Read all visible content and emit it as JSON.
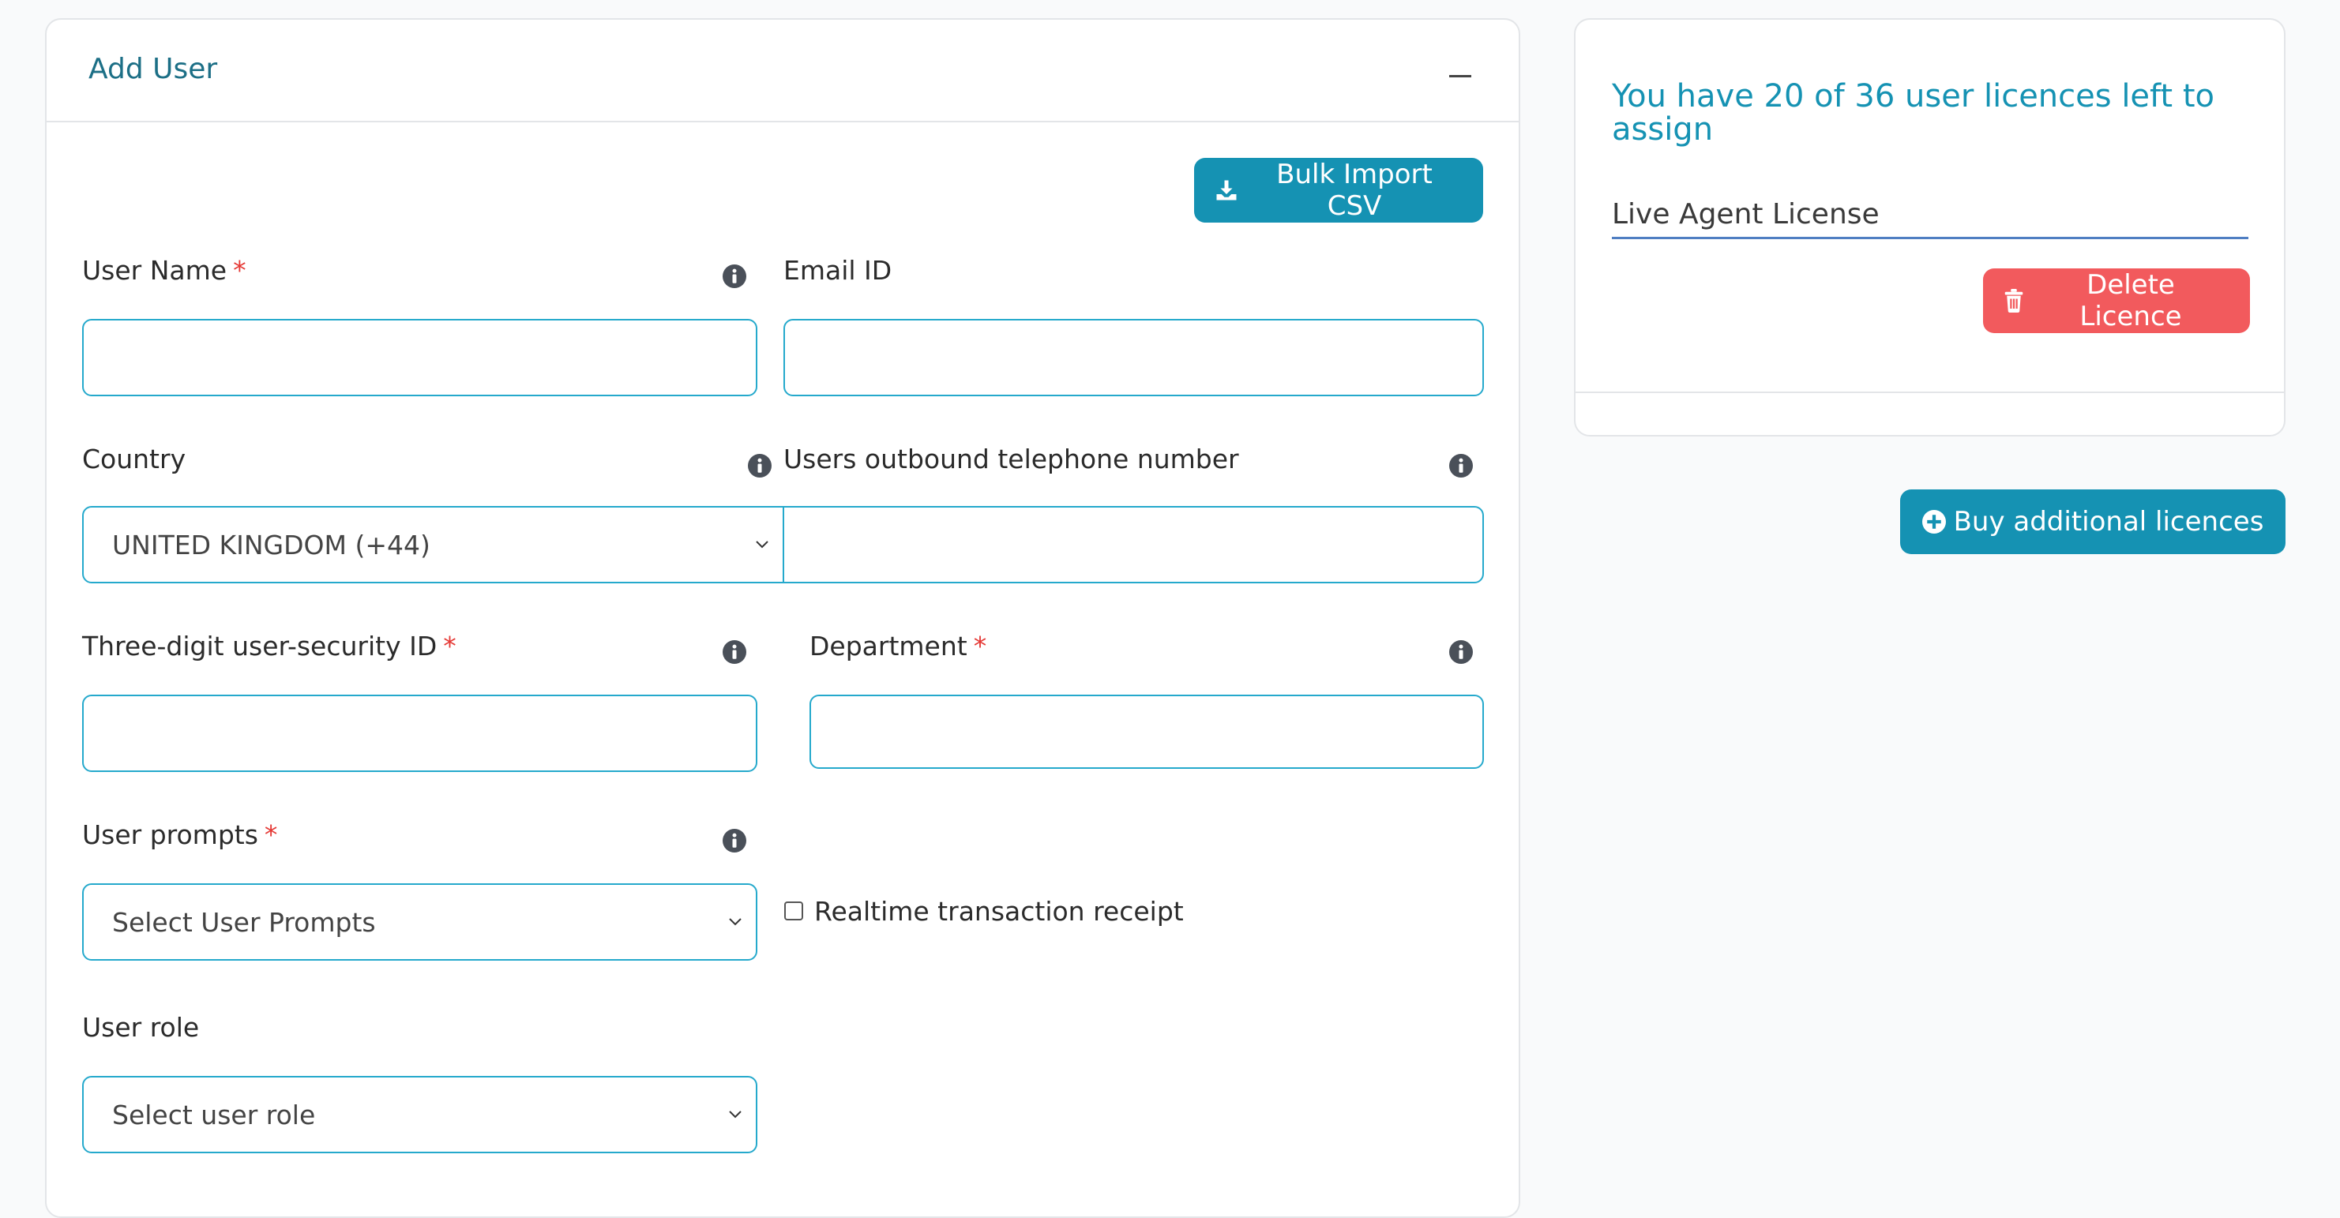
{
  "add_user": {
    "title": "Add User",
    "bulk_import_label": "Bulk Import CSV",
    "fields": {
      "user_name": {
        "label": "User Name",
        "required_mark": "*"
      },
      "email": {
        "label": "Email ID"
      },
      "country": {
        "label": "Country",
        "selected": "UNITED KINGDOM (+44)"
      },
      "outbound_phone": {
        "label": "Users outbound telephone number"
      },
      "security_id": {
        "label": "Three-digit user-security ID",
        "required_mark": "*"
      },
      "department": {
        "label": "Department",
        "required_mark": "*"
      },
      "user_prompts": {
        "label": "User prompts",
        "required_mark": "*",
        "selected": "Select User Prompts"
      },
      "realtime_receipt": {
        "label": "Realtime transaction receipt",
        "checked": false
      },
      "user_role": {
        "label": "User role",
        "selected": "Select user role"
      }
    }
  },
  "licences": {
    "summary": "You have 20 of 36 user licences left to assign",
    "licence_name": "Live Agent License",
    "delete_label": "Delete Licence",
    "buy_label": "Buy additional licences"
  },
  "icons": {
    "collapse": "minus-icon",
    "bulk_import": "download-icon",
    "info": "info-icon",
    "delete": "trash-icon",
    "buy": "plus-circle-icon",
    "dropdown": "chevron-down-icon"
  },
  "colors": {
    "accent": "#1592b3",
    "title": "#1c6f86",
    "danger": "#f25a5d",
    "input_border": "#25a9cc",
    "required": "#e53935"
  }
}
